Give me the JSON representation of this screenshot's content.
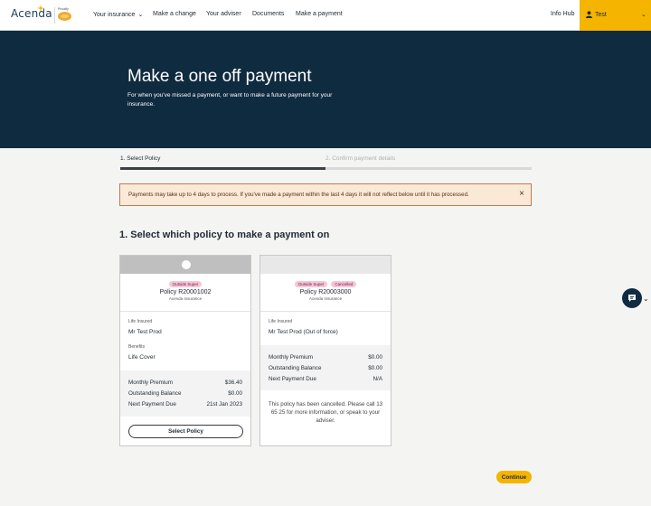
{
  "header": {
    "logo_text": "Acenda",
    "partner_text": "Proudly",
    "nav": [
      {
        "label": "Your insurance",
        "has_dropdown": true
      },
      {
        "label": "Make a change"
      },
      {
        "label": "Your adviser"
      },
      {
        "label": "Documents"
      },
      {
        "label": "Make a payment"
      },
      {
        "label": "Info Hub"
      }
    ],
    "user": {
      "name": "Test",
      "icon": "user-icon"
    },
    "accent_color": "#f4b400"
  },
  "hero": {
    "title": "Make a one off payment",
    "subtitle": "For when you've missed a payment, or want to make a future payment for your insurance.",
    "background": "#0f2b40"
  },
  "steps": [
    {
      "label": "1. Select Policy",
      "active": true
    },
    {
      "label": "2. Confirm payment details",
      "active": false
    }
  ],
  "alert": {
    "text": "Payments may take up to 4 days to process. If you've made a payment within the last 4 days it will not reflect below until it has processed.",
    "close_icon": "close-icon"
  },
  "section_title": "1. Select which policy to make a payment on",
  "policies": [
    {
      "badges": [
        "Outside Super"
      ],
      "policy": "Policy R20001002",
      "insurer": "Acenda Insurance",
      "life_insured_label": "Life Insured",
      "life_insured": "Mr Test Prod",
      "benefits_label": "Benefits",
      "benefits": "Life Cover",
      "rows": [
        {
          "label": "Monthly Premium",
          "value": "$36.40"
        },
        {
          "label": "Outstanding Balance",
          "value": "$0.00"
        },
        {
          "label": "Next Payment Due",
          "value": "21st Jan 2023"
        }
      ],
      "button": "Select Policy"
    },
    {
      "badges": [
        "Outside Super",
        "Cancelled"
      ],
      "policy": "Policy R20003000",
      "insurer": "Acenda Insurance",
      "life_insured_label": "Life Insured",
      "life_insured": "Mr Test Prod (Out of force)",
      "rows": [
        {
          "label": "Monthly Premium",
          "value": "$0.00"
        },
        {
          "label": "Outstanding Balance",
          "value": "$0.00"
        },
        {
          "label": "Next Payment Due",
          "value": "N/A"
        }
      ],
      "note": "This policy has been cancelled. Please call 13 65 25 for more information, or speak to your adviser."
    }
  ],
  "continue_label": "Continue",
  "chat_icon": "chat-icon"
}
